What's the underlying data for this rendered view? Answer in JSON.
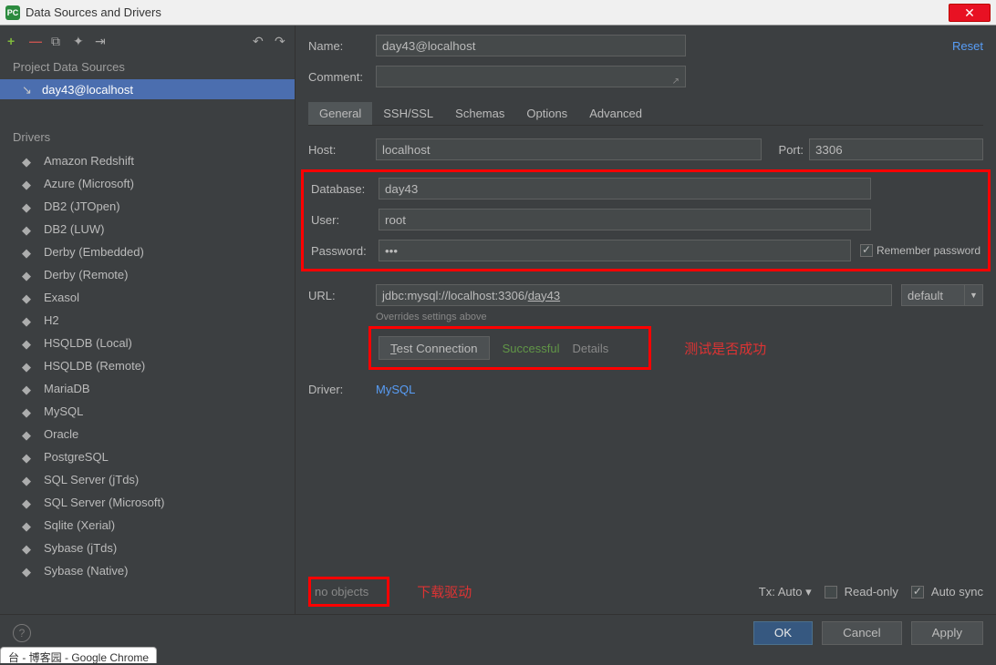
{
  "title": "Data Sources and Drivers",
  "app_icon_text": "PC",
  "reset_label": "Reset",
  "sidebar": {
    "project_header": "Project Data Sources",
    "project_item": "day43@localhost",
    "drivers_header": "Drivers",
    "drivers": [
      "Amazon Redshift",
      "Azure (Microsoft)",
      "DB2 (JTOpen)",
      "DB2 (LUW)",
      "Derby (Embedded)",
      "Derby (Remote)",
      "Exasol",
      "H2",
      "HSQLDB (Local)",
      "HSQLDB (Remote)",
      "MariaDB",
      "MySQL",
      "Oracle",
      "PostgreSQL",
      "SQL Server (jTds)",
      "SQL Server (Microsoft)",
      "Sqlite (Xerial)",
      "Sybase (jTds)",
      "Sybase (Native)"
    ]
  },
  "form": {
    "name_label": "Name:",
    "name_value": "day43@localhost",
    "comment_label": "Comment:",
    "host_label": "Host:",
    "host_value": "localhost",
    "port_label": "Port:",
    "port_value": "3306",
    "database_label": "Database:",
    "database_value": "day43",
    "user_label": "User:",
    "user_value": "root",
    "password_label": "Password:",
    "password_value": "•••",
    "remember_label": "Remember password",
    "url_label": "URL:",
    "url_prefix": "jdbc:mysql://localhost:3306/",
    "url_db": "day43",
    "url_option": "default",
    "overrides": "Overrides settings above",
    "test_btn": "Test Connection",
    "successful": "Successful",
    "details": "Details",
    "driver_label": "Driver:",
    "driver_value": "MySQL"
  },
  "tabs": [
    "General",
    "SSH/SSL",
    "Schemas",
    "Options",
    "Advanced"
  ],
  "annotations": {
    "test": "测试是否成功",
    "download": "下载驱动"
  },
  "status": {
    "no_objects": "no objects",
    "tx_label": "Tx: Auto",
    "readonly": "Read-only",
    "autosync": "Auto sync"
  },
  "buttons": {
    "ok": "OK",
    "cancel": "Cancel",
    "apply": "Apply"
  },
  "chrome_tab": "台 - 博客园 - Google Chrome"
}
